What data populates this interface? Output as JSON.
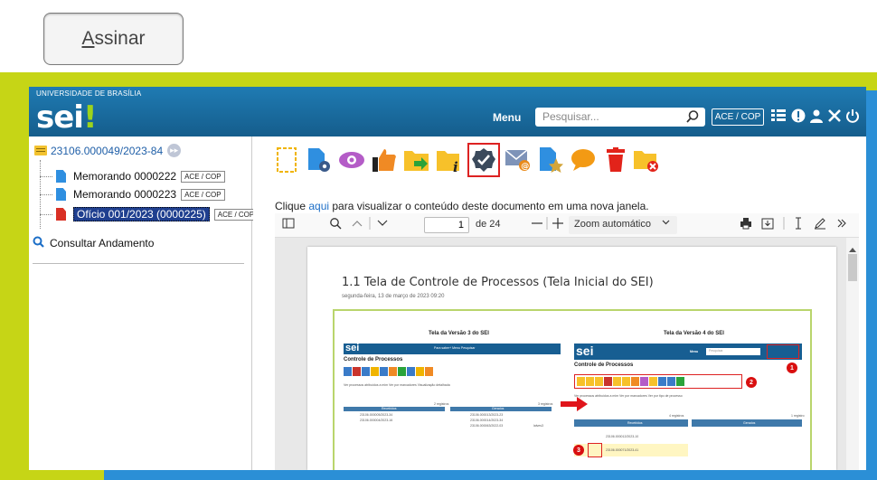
{
  "sign_button": {
    "label_first": "A",
    "label_rest": "ssinar"
  },
  "sei": {
    "institution": "UNIVERSIDADE DE BRASÍLIA",
    "logo": "sei",
    "menu_label": "Menu",
    "search_placeholder": "Pesquisar...",
    "unit": "ACE / COP"
  },
  "tree": {
    "process": "23106.000049/2023-84",
    "items": [
      {
        "label": "Memorando 0000222",
        "unit": "ACE / COP",
        "type": "document"
      },
      {
        "label": "Memorando 0000223",
        "unit": "ACE / COP",
        "type": "document"
      },
      {
        "label": "Ofício 001/2023 (0000225)",
        "unit": "ACE / COP",
        "type": "pdf"
      }
    ],
    "consultar": "Consultar Andamento"
  },
  "toolbar": {
    "icons": [
      "new-document-icon",
      "process-settings-icon",
      "view-icon",
      "like-icon",
      "send-process-icon",
      "process-info-icon",
      "sign-document-icon",
      "send-email-icon",
      "bookmark-icon",
      "comment-icon",
      "delete-icon",
      "cancel-icon"
    ],
    "selected": "sign-document-icon"
  },
  "hint": {
    "before": "Clique ",
    "link": "aqui",
    "after": " para visualizar o conteúdo deste documento em uma nova janela."
  },
  "viewer": {
    "page_value": "1",
    "page_total": "de 24",
    "zoom": "Zoom automático"
  },
  "document": {
    "title": "1.1 Tela de Controle de Processos (Tela Inicial do SEI)",
    "subtitle": "segunda-feira, 13 de março de 2023     09:20",
    "left_caption": "Tela da Versão 3 do SEI",
    "right_caption": "Tela da Versão 4 do SEI",
    "left_heading": "Controle de Processos",
    "right_heading": "Controle de Processos",
    "left_menu": "Para saber+  Menu  Pesquisar",
    "right_menu": "Menu",
    "right_search": "Pesquisar",
    "left_filters": "Ver processos atribuídos a mim     Ver por marcadores          Visualização detalhada",
    "right_filters": "Ver processos atribuídos a mim    Ver por marcadores    Ver por tipo de processo",
    "left_count_a": "2 registros",
    "left_count_b": "3 registros",
    "right_count_a": "4 registros",
    "right_count_b": "1 registro",
    "col_recebidos": "Recebidos",
    "col_gerados": "Gerados",
    "left_rows_a": [
      "23106.000005/2023-34",
      "23106.000004/2023-16"
    ],
    "left_rows_b": [
      "23106.000013/2023-23",
      "23106.000014/2023-34",
      "23106.000063/2022-03"
    ],
    "left_user": "lalves3",
    "right_rows": [
      "23106.000012/2023-10",
      "23106.000071/2023-41"
    ],
    "callouts": [
      "1",
      "2",
      "3"
    ]
  }
}
